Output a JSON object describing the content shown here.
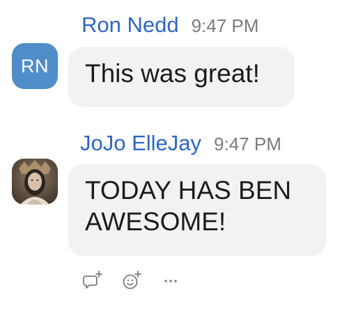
{
  "messages": [
    {
      "author": "Ron Nedd",
      "time": "9:47 PM",
      "avatar_initials": "RN",
      "text": "This was great!"
    },
    {
      "author": "JoJo ElleJay",
      "time": "9:47 PM",
      "text": "TODAY HAS BEN AWESOME!"
    }
  ],
  "actions": [
    {
      "icon": "reply-plus-icon"
    },
    {
      "icon": "add-reaction-icon"
    },
    {
      "icon": "more-options-icon"
    }
  ],
  "colors": {
    "name": "#2f66c4",
    "time": "#7b7b7b",
    "bubble": "#f2f2f5",
    "avatar_rn": "#4f8ec9"
  }
}
